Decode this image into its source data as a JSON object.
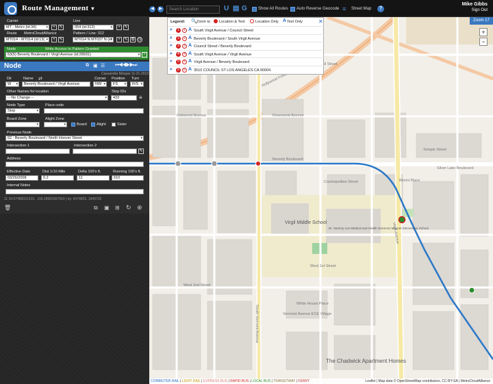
{
  "app": {
    "title": "Route Management",
    "user_name": "Mike Gibbs",
    "sign_out": "Sign Out"
  },
  "toolbar": {
    "search_placeholder": "Search Location",
    "show_all_routes": "Show All Routes",
    "auto_reverse_geocode": "Auto Reverse Geocode",
    "street_map": "Street Map"
  },
  "form": {
    "carrier_label": "Carrier",
    "carrier_value": "MT - Metro (id:34)",
    "line_label": "Line",
    "line_value": "054 (id:312)",
    "route_label": "Route",
    "metrocloudalliance_label": "MetroCloudAlliance",
    "route_value": "MT014 - MT014 (id:13(",
    "pattern_label": "Pattern / Line: 312",
    "pattern_value": "MT014 N MT037 N (id",
    "node_label": "Node",
    "write_access": "Write Access to Pattern Granted",
    "node_value": "63(5) Beverly Boulevard / Virgil Avenue (id:28931)"
  },
  "node": {
    "title": "Node",
    "meta": "Cassandra Morgan 11-21-2013",
    "dir_label": "Dir",
    "dir_value": "W",
    "name_label": "Name",
    "name_value": "Beverly Boulevard / Virgil Avenue",
    "corner_label": "Corner",
    "corner_value": "NW",
    "position_label": "Position",
    "position_value": "FS",
    "turn_label": "Turn",
    "turn_value": "R/S",
    "other_names_label": "Other Names for location",
    "other_names_value": "-- No Change --",
    "stop_ids_label": "Stop IDs",
    "stop_ids_value": "433",
    "node_type_label": "Node Type",
    "node_type_value": "Stop",
    "place_code_label": "Place code",
    "board_zone_label": "Board Zone",
    "alight_zone_label": "Alight Zone",
    "board": "Board",
    "alight": "Alight",
    "sister": "Sister",
    "previous_node_label": "Previous Node",
    "previous_node_value": "62 : Beverly Boulevard / North Hoover Street",
    "intersection1_label": "Intersection 1",
    "intersection2_label": "Intersection 2",
    "address_label": "Address",
    "effective_date_label": "Effective Date",
    "effective_date_value": "03/26/2008",
    "dist_label": "Dist 1/10 Mile",
    "dist_value": "0.2",
    "delta_label": "Delta 100's ft.",
    "delta_value": "11",
    "running_label": "Running 100's ft.",
    "running_value": "610",
    "internal_notes_label": "Internal Notes",
    "coords": "11 34.07488331315, -118.28681667663 | by: 6474825, 1849732"
  },
  "legend": {
    "title": "Legend:",
    "zoom_to": "Zoom to",
    "location_text": "Location & Text",
    "location_only": "Location Only",
    "text_only": "Text Only",
    "rows": [
      {
        "num": "1",
        "text": "South Virgil Avenue / Council Street"
      },
      {
        "num": "2",
        "text": "Beverly Boulevard / South Virgil Avenue"
      },
      {
        "num": "3",
        "text": "Council Street / Beverly Boulevard"
      },
      {
        "num": "4",
        "text": "South Virgil Avenue / Virgil Avenue"
      },
      {
        "num": "5",
        "text": "Virgil Avenue / Beverly Boulevard"
      },
      {
        "num": "6",
        "text": "3510 COUNCIL ST LOS ANGELES CA 90004"
      }
    ]
  },
  "map": {
    "zoom": "Zoom 17",
    "labels": {
      "hollywood_freeway": "Hollywood Freeway",
      "temple_street": "Temple Street",
      "silver_lake_blvd": "Silver Lake Boulevard",
      "council_street": "Council Street",
      "oakwood_avenue": "Oakwood Avenue",
      "rosewood_avenue": "Rosewood Avenue",
      "cosmopolitan": "Cosmopolitan Street",
      "beverly_blvd": "Beverly Boulevard",
      "virgil_school": "Virgil Middle School",
      "dr_sammy": "Dr. Sammy Lee Medical and Health Sciences Magnet Elementary School",
      "w_1st": "West 1st Street",
      "w_2nd": "West 2nd Street",
      "virgil_ave": "Virgil Avenue",
      "vermont": "South Vermont Avenue",
      "chadwick": "The Chadwick Apartment Homes",
      "white_house": "White House Place",
      "vermont_ecc": "Vermont Avenue ECE Village",
      "bimini": "Bimini Place"
    }
  },
  "footer": {
    "commuter_rail": "COMMUTER RAIL",
    "light_rail": "LIGHT RAIL",
    "express_bus": "EXPRESS BUS",
    "rapid_bus": "RAPID BUS",
    "local_bus": "LOCAL BUS",
    "transitway": "TRANSITWAY",
    "ferry": "FERRY",
    "attribution": "Leaflet | Map data © OpenStreetMap contributors, CC-BY-SA | MetroCloudAlliance"
  }
}
